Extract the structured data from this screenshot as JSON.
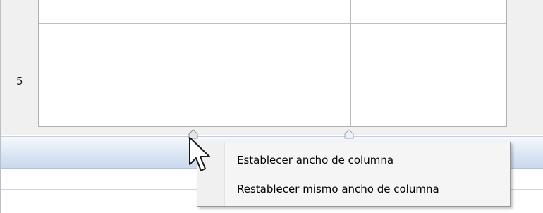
{
  "table": {
    "visible_row_number": "5"
  },
  "context_menu": {
    "items": [
      {
        "label": "Establecer ancho de columna"
      },
      {
        "label": "Restablecer mismo ancho de columna"
      }
    ]
  },
  "colors": {
    "ruler_top": "#f7f9fc",
    "ruler_bottom": "#cbd9ee",
    "menu_background": "#f5f5f5",
    "menu_border": "#979797",
    "grid_line": "#bdbdbd"
  },
  "icons": {
    "column_markers": [
      "column-marker-icon",
      "column-marker-icon"
    ],
    "pointer": "mouse-pointer-icon"
  }
}
